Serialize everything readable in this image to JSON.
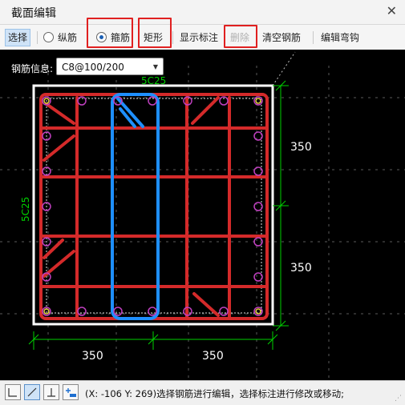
{
  "window": {
    "title": "截面编辑",
    "close_icon": "close-icon"
  },
  "toolbar": {
    "select_label": "选择",
    "longitudinal_label": "纵筋",
    "stirrup_label": "箍筋",
    "stirrup_selected": true,
    "rectangle_label": "矩形",
    "show_annotation_label": "显示标注",
    "delete_label": "删除",
    "clear_label": "清空钢筋",
    "edit_hook_label": "编辑弯钩",
    "more_icon": "double-chevron-right-icon"
  },
  "rebar_info": {
    "label": "钢筋信息:",
    "value": "C8@100/200"
  },
  "drawing": {
    "left_rebar_label": "5C25",
    "top_rebar_label": "5C25",
    "right_dims": [
      "350",
      "350"
    ],
    "bottom_dims": [
      "350",
      "350"
    ],
    "colors": {
      "stirrup": "#d42a2a",
      "selected": "#1e8fff",
      "rebar_circle": "#c040c0",
      "dim": "#00d000",
      "outline": "#ffffff"
    }
  },
  "statusbar": {
    "buttons": [
      "corner-icon",
      "diagonal-line-icon",
      "perpendicular-icon",
      "add-annotation-icon"
    ],
    "text": "(X: -106 Y: 269)选择钢筋进行编辑，选择标注进行修改或移动;"
  }
}
